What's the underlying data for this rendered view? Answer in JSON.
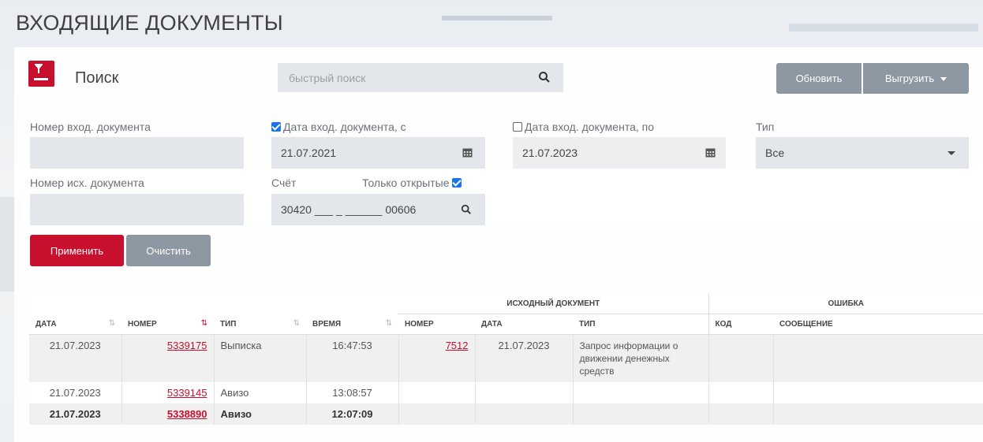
{
  "page": {
    "title": "ВХОДЯЩИЕ ДОКУМЕНТЫ"
  },
  "search": {
    "title": "Поиск",
    "quick_placeholder": "быстрый поиск",
    "refresh_label": "Обновить",
    "export_label": "Выгрузить"
  },
  "filters": {
    "in_doc_number_label": "Номер вход. документа",
    "in_doc_number_value": "",
    "out_doc_number_label": "Номер исх. документа",
    "out_doc_number_value": "",
    "date_from_label": "Дата вход. документа, с",
    "date_from_checked": true,
    "date_from_value": "21.07.2021",
    "date_to_label": "Дата вход. документа, по",
    "date_to_checked": false,
    "date_to_value": "21.07.2023",
    "account_label": "Счёт",
    "account_value": "30420 ___ _ ______ 00606",
    "only_open_label": "Только открытые",
    "only_open_checked": true,
    "type_label": "Тип",
    "type_value": "Все",
    "apply_label": "Применить",
    "clear_label": "Очистить"
  },
  "table": {
    "group_source": "ИСХОДНЫЙ ДОКУМЕНТ",
    "group_error": "ОШИБКА",
    "columns": {
      "date": "ДАТА",
      "number": "НОМЕР",
      "type": "ТИП",
      "time": "ВРЕМЯ",
      "src_number": "НОМЕР",
      "src_date": "ДАТА",
      "src_type": "ТИП",
      "err_code": "КОД",
      "err_message": "СООБЩЕНИЕ"
    },
    "rows": [
      {
        "date": "21.07.2023",
        "number": "5339175",
        "type": "Выписка",
        "time": "16:47:53",
        "src_number": "7512",
        "src_date": "21.07.2023",
        "src_type": "Запрос информации о движении денежных средств",
        "err_code": "",
        "err_message": ""
      },
      {
        "date": "21.07.2023",
        "number": "5339145",
        "type": "Авизо",
        "time": "13:08:57",
        "src_number": "",
        "src_date": "",
        "src_type": "",
        "err_code": "",
        "err_message": ""
      },
      {
        "date": "21.07.2023",
        "number": "5338890",
        "type": "Авизо",
        "time": "12:07:09",
        "src_number": "",
        "src_date": "",
        "src_type": "",
        "err_code": "",
        "err_message": ""
      }
    ]
  },
  "colors": {
    "accent": "#c8102e",
    "button_gray": "#8e98a2",
    "field_bg": "#e3e7ec"
  }
}
